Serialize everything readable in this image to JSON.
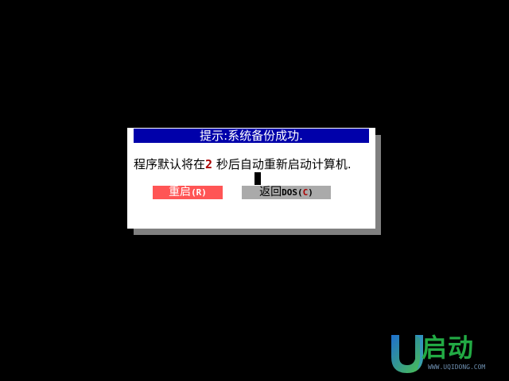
{
  "dialog": {
    "title": "提示:系统备份成功.",
    "message_prefix": "程序默认将在",
    "countdown_seconds": "2",
    "message_suffix": " 秒后自动重新启动计算机.",
    "buttons": {
      "restart": {
        "label": "重启",
        "hotkey": "(R)"
      },
      "return_dos": {
        "label": "返回",
        "dos": "DOS",
        "hotkey_open": "(",
        "hotkey": "C",
        "hotkey_close": ")"
      }
    }
  },
  "branding": {
    "logo_text": "启动",
    "logo_url": "WWW.UQIDONG.COM",
    "logo_colors": {
      "u_blue": "#1e6fd0",
      "u_green": "#4cc24c",
      "text_green": "#22aa44"
    }
  },
  "colors": {
    "background": "#000000",
    "title_bar": "#0000aa",
    "dialog_bg": "#ffffff",
    "shadow": "#808080",
    "restart_button": "#ff5555",
    "dos_button": "#aaaaaa",
    "countdown": "#aa0000"
  }
}
